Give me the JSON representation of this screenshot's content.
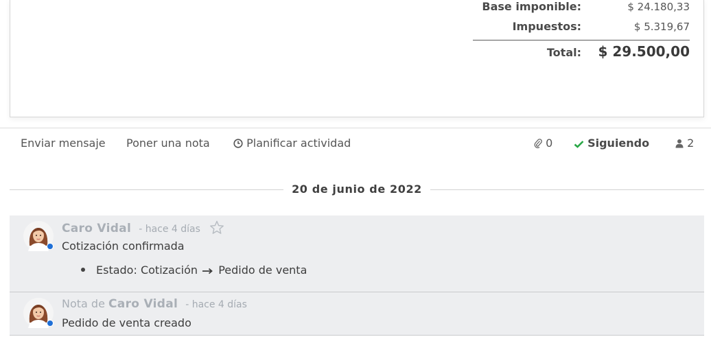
{
  "totals": {
    "base_label": "Base imponible:",
    "base_value": "$ 24.180,33",
    "tax_label": "Impuestos:",
    "tax_value": "$ 5.319,67",
    "total_label": "Total:",
    "total_value": "$ 29.500,00"
  },
  "chatter": {
    "send_message": "Enviar mensaje",
    "log_note": "Poner una nota",
    "schedule_activity": "Planificar actividad",
    "attachments_count": "0",
    "following_label": "Siguiendo",
    "followers_count": "2",
    "following_color": "#28a745"
  },
  "date_separator": "20 de junio de 2022",
  "messages": [
    {
      "author": "Caro Vidal",
      "time": "- hace 4 días",
      "body": "Cotización confirmada",
      "tracking": {
        "field": "Estado:",
        "old": "Cotización",
        "new": "Pedido de venta"
      }
    },
    {
      "prefix": "Nota de",
      "author": "Caro Vidal",
      "time": "- hace 4 días",
      "body": "Pedido de venta creado"
    }
  ]
}
